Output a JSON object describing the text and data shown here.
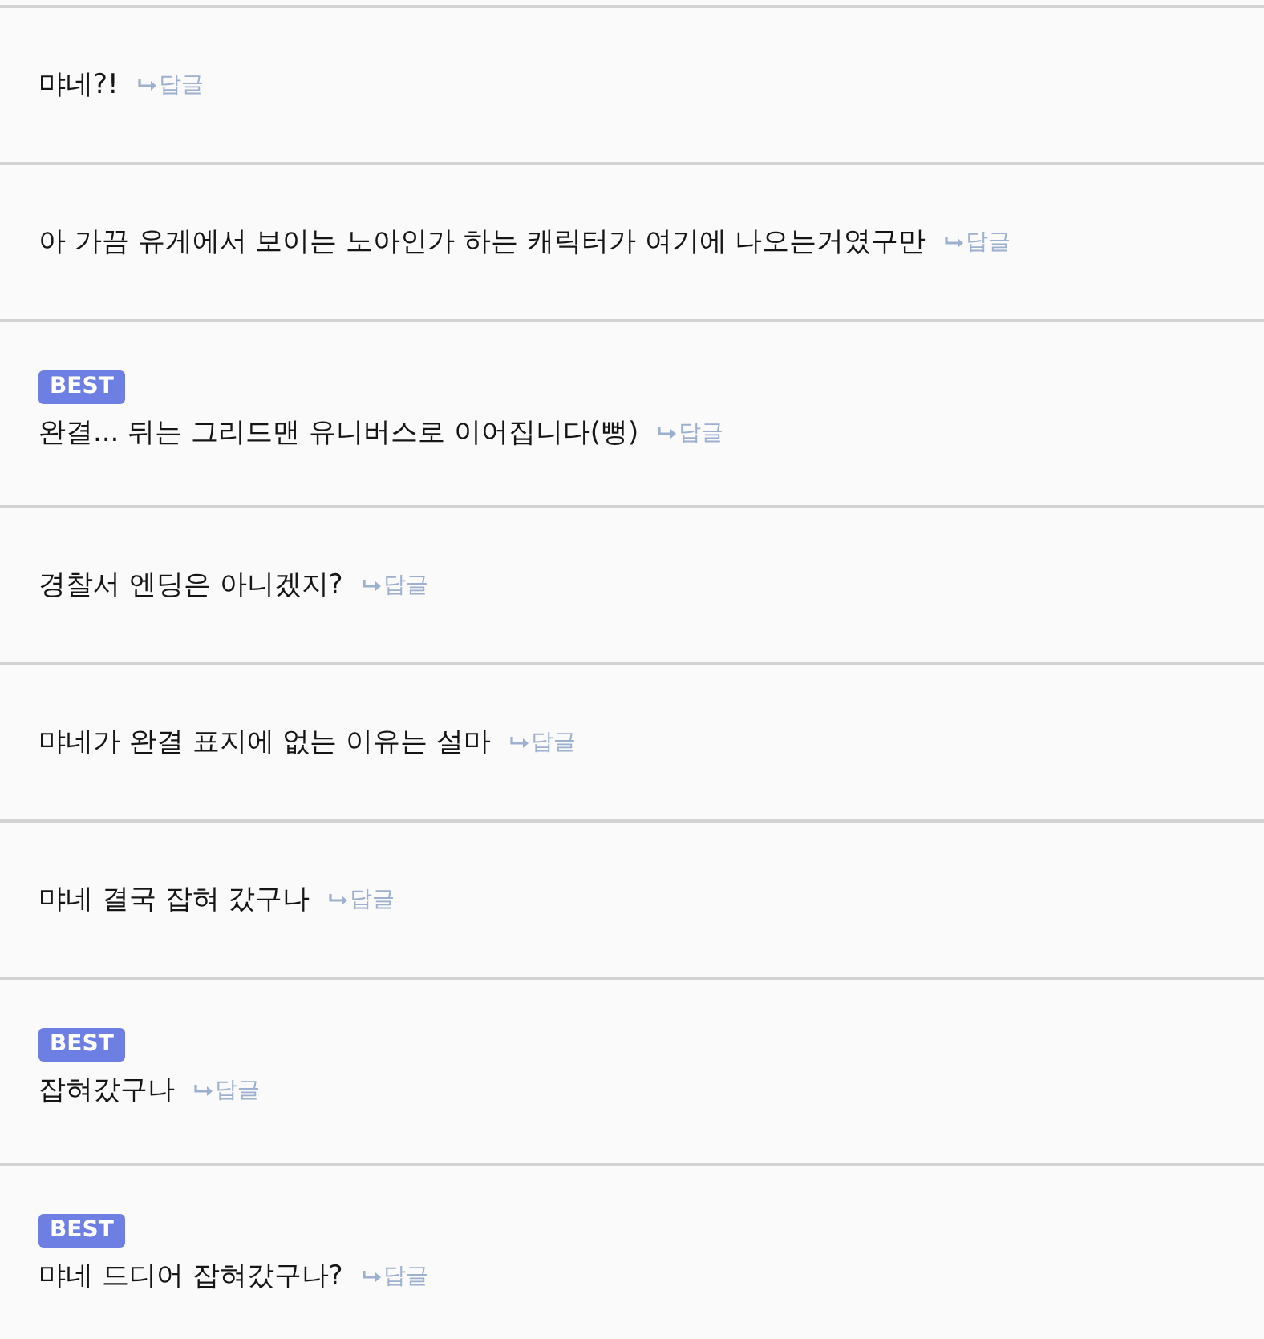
{
  "comments": [
    {
      "text": "먀네?!",
      "reply": "답글"
    },
    {
      "text": "아 가끔 유게에서 보이는 노아인가 하는 캐릭터가 여기에 나오는거였구만",
      "reply": "답글"
    },
    {
      "badge": "BEST",
      "text": "완결... 뒤는 그리드맨 유니버스로 이어집니다(뻥)",
      "reply": "답글"
    },
    {
      "text": "경찰서 엔딩은 아니겠지?",
      "reply": "답글"
    },
    {
      "text": "먀네가 완결 표지에 없는 이유는 설마",
      "reply": "답글"
    },
    {
      "text": "먀네 결국 잡혀 갔구나",
      "reply": "답글"
    },
    {
      "badge": "BEST",
      "text": "잡혀갔구나",
      "reply": "답글"
    },
    {
      "badge": "BEST",
      "text": "먀네 드디어 잡혀갔구나?",
      "reply": "답글"
    }
  ]
}
